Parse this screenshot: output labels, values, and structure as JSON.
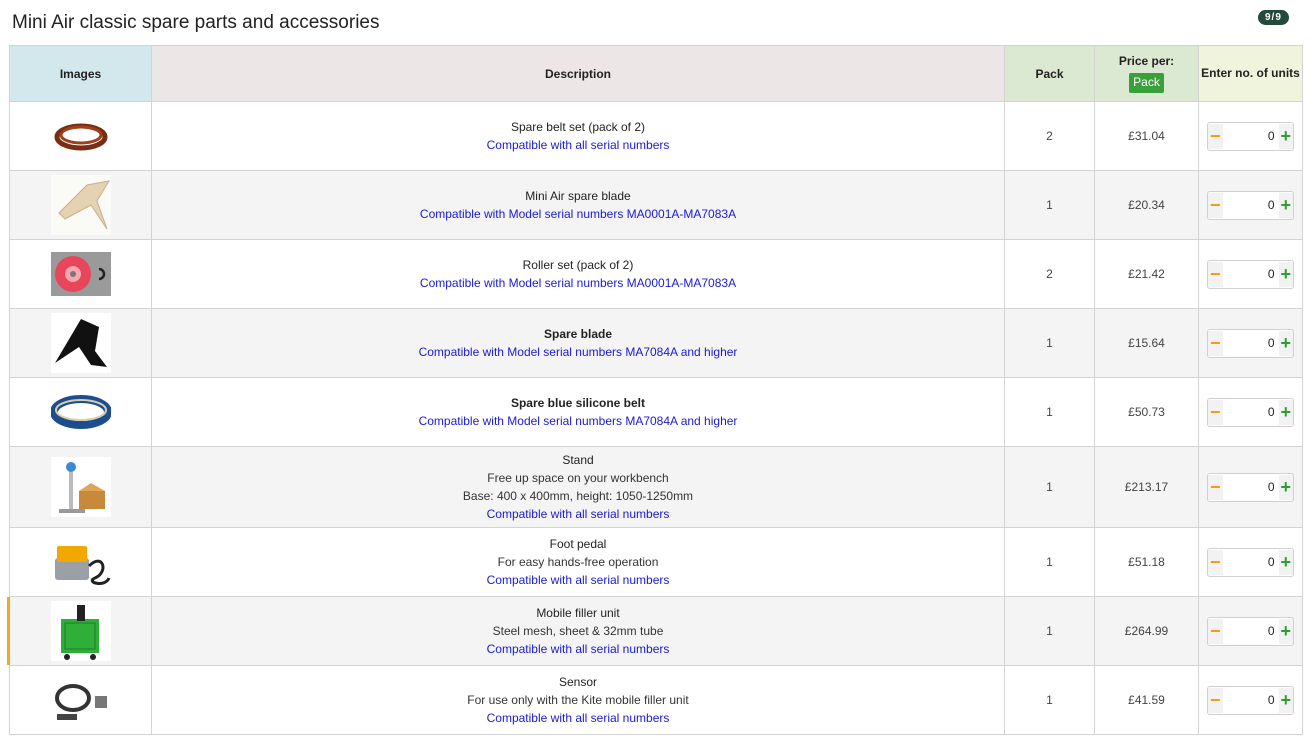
{
  "page": {
    "title": "Mini Air classic spare parts and accessories",
    "counter": "9/9"
  },
  "table": {
    "headers": {
      "images": "Images",
      "description": "Description",
      "pack": "Pack",
      "price_per": "Price per:",
      "price_unit": "Pack",
      "qty": "Enter no. of units"
    },
    "rows": [
      {
        "name": "Spare belt set (pack of 2)",
        "bold": false,
        "extra": [],
        "compat": "Compatible with all serial numbers",
        "pack": "2",
        "price": "£31.04",
        "qty": "0",
        "icon": "brown-belt-image"
      },
      {
        "name": "Mini Air spare blade",
        "bold": false,
        "extra": [],
        "compat": "Compatible with Model serial numbers MA0001A-MA7083A",
        "pack": "1",
        "price": "£20.34",
        "qty": "0",
        "icon": "beige-blade-image"
      },
      {
        "name": "Roller set (pack of 2)",
        "bold": false,
        "extra": [],
        "compat": "Compatible with Model serial numbers MA0001A-MA7083A",
        "pack": "2",
        "price": "£21.42",
        "qty": "0",
        "icon": "red-roller-image"
      },
      {
        "name": "Spare blade",
        "bold": true,
        "extra": [],
        "compat": "Compatible with Model serial numbers MA7084A and higher",
        "pack": "1",
        "price": "£15.64",
        "qty": "0",
        "icon": "black-blade-image"
      },
      {
        "name": "Spare blue silicone belt",
        "bold": true,
        "extra": [],
        "compat": "Compatible with Model serial numbers MA7084A and higher",
        "pack": "1",
        "price": "£50.73",
        "qty": "0",
        "icon": "blue-belt-image"
      },
      {
        "name": "Stand",
        "bold": false,
        "extra": [
          "Free up space on your workbench",
          "Base: 400 x 400mm, height: 1050-1250mm"
        ],
        "compat": "Compatible with all serial numbers",
        "pack": "1",
        "price": "£213.17",
        "qty": "0",
        "icon": "stand-image"
      },
      {
        "name": "Foot pedal",
        "bold": false,
        "extra": [
          "For easy hands-free operation"
        ],
        "compat": "Compatible with all serial numbers",
        "pack": "1",
        "price": "£51.18",
        "qty": "0",
        "icon": "foot-pedal-image"
      },
      {
        "name": "Mobile filler unit",
        "bold": false,
        "extra": [
          "Steel mesh, sheet & 32mm tube"
        ],
        "compat": "Compatible with all serial numbers",
        "pack": "1",
        "price": "£264.99",
        "qty": "0",
        "icon": "filler-unit-image"
      },
      {
        "name": "Sensor",
        "bold": false,
        "extra": [
          "For use only with the Kite mobile filler unit"
        ],
        "compat": "Compatible with all serial numbers",
        "pack": "1",
        "price": "£41.59",
        "qty": "0",
        "icon": "sensor-image"
      }
    ]
  },
  "stepper": {
    "minus": "−",
    "plus": "+"
  },
  "colors": {
    "accent_green": "#3aa13a",
    "minus_orange": "#f39c12",
    "link_blue": "#1a1ad6",
    "row_marker": "#f5a623"
  }
}
